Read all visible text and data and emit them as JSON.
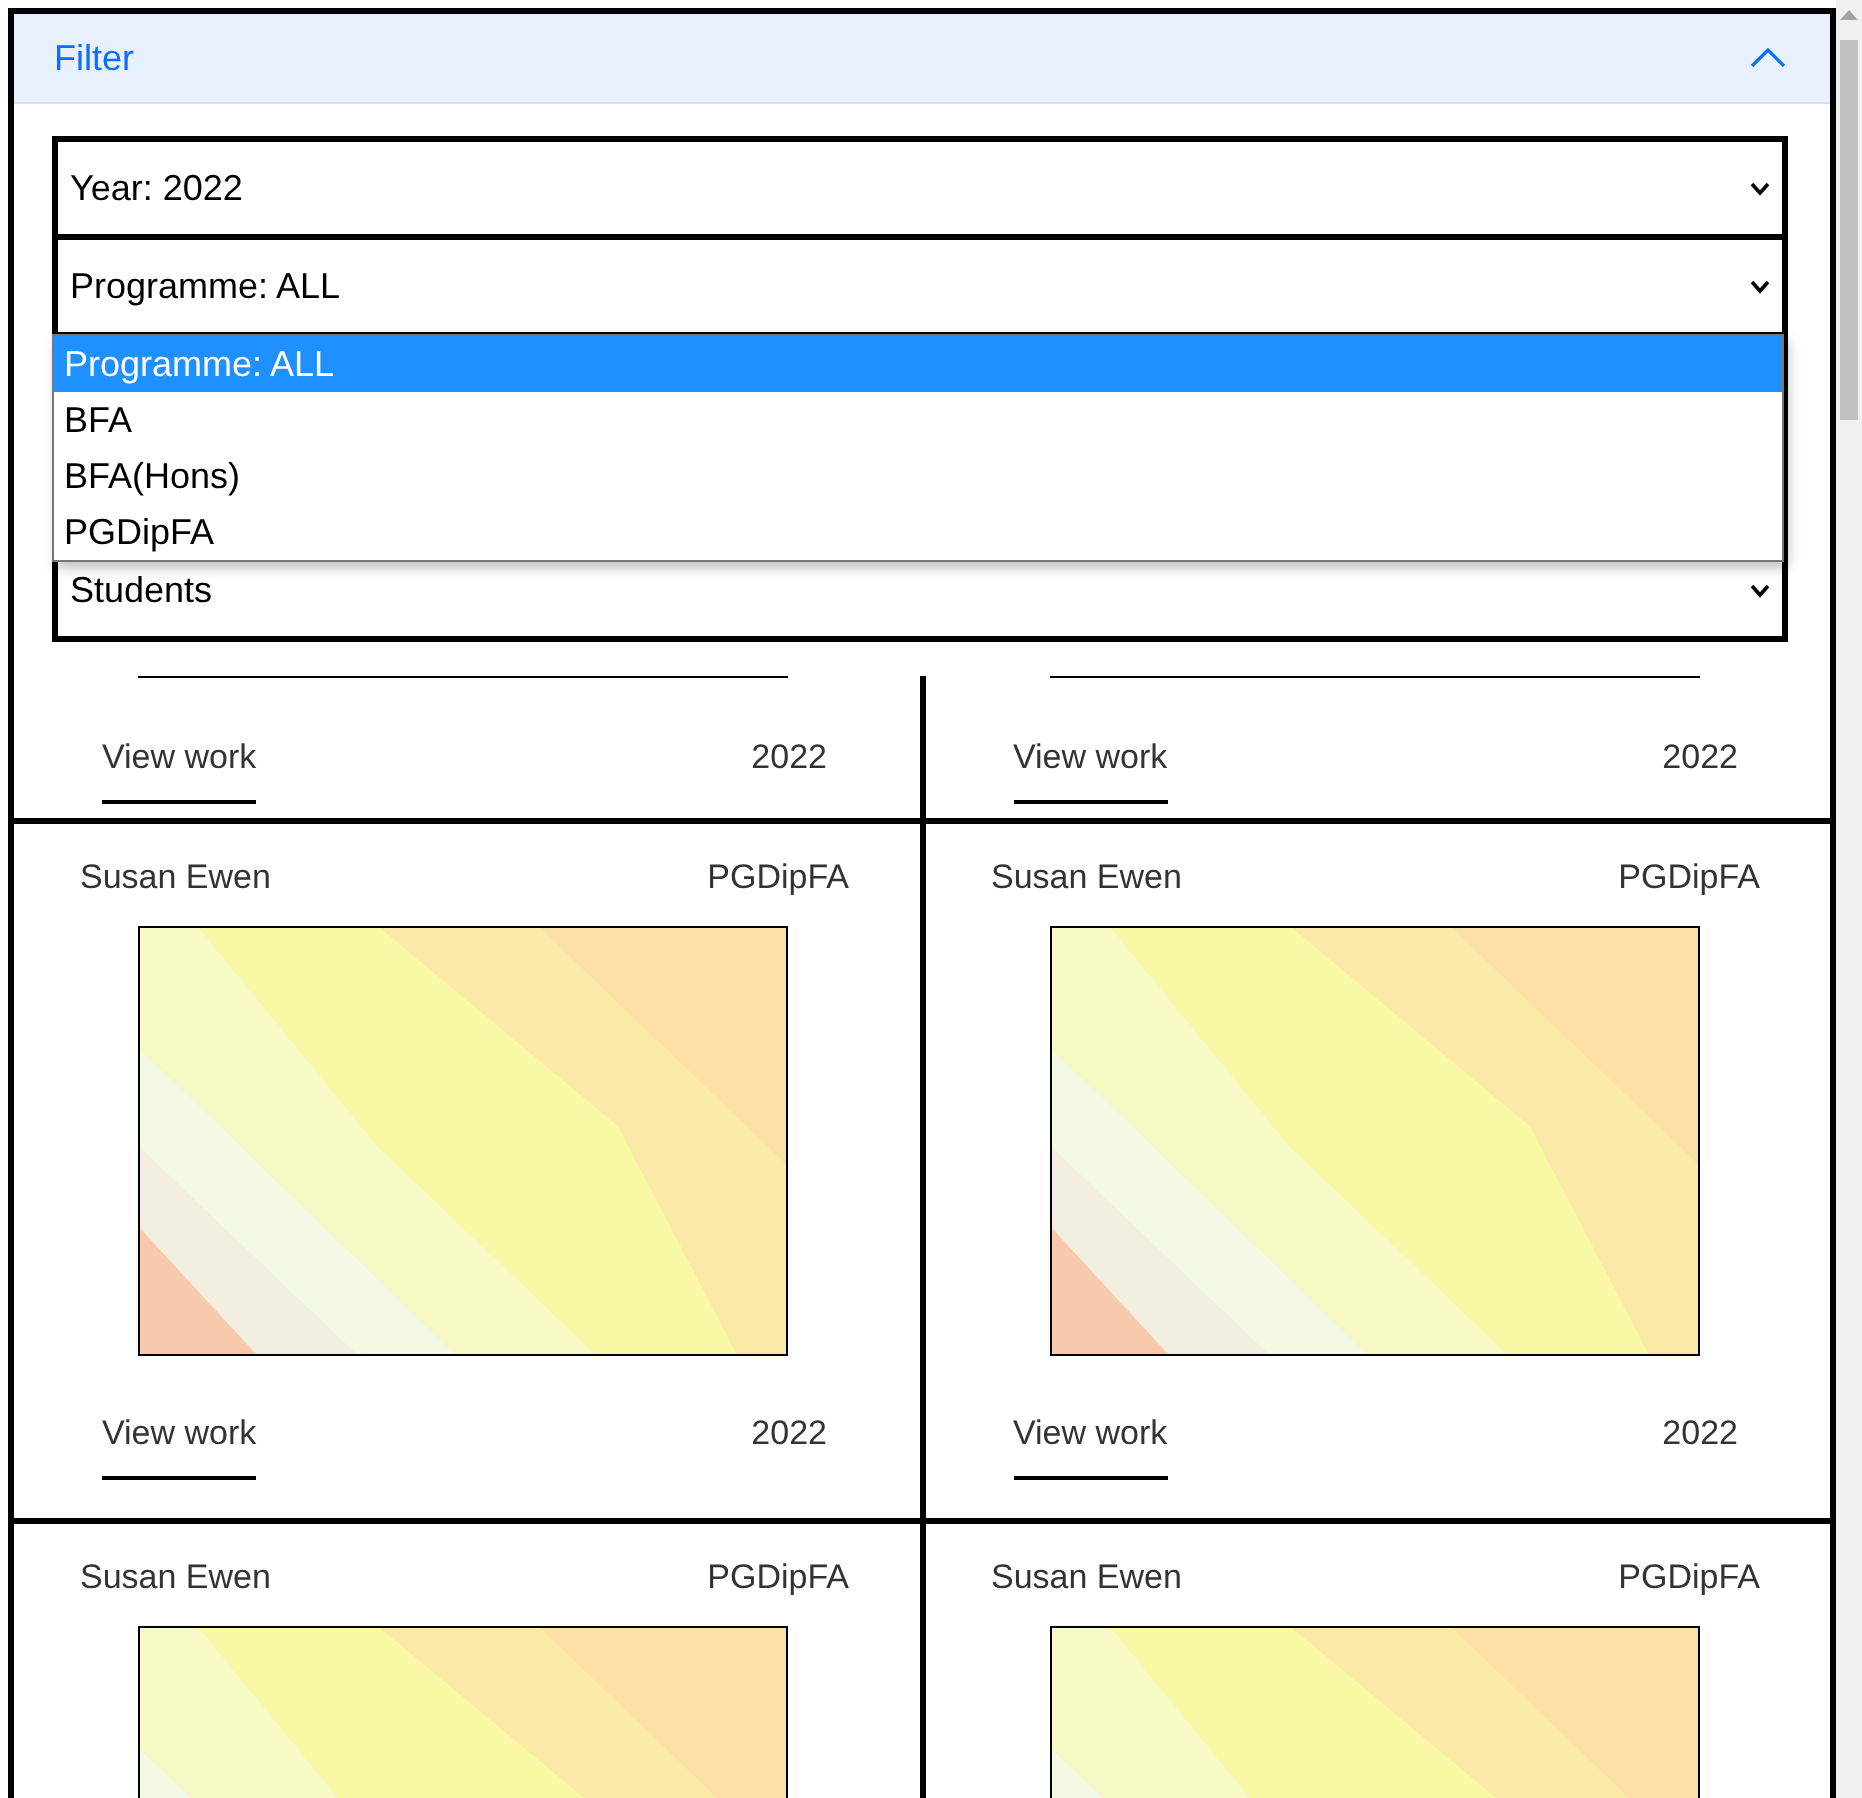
{
  "filter": {
    "title": "Filter",
    "expanded": true,
    "selects": [
      {
        "value": "Year: 2022"
      },
      {
        "value": "Programme: ALL",
        "open": true,
        "options": [
          {
            "label": "Programme: ALL",
            "selected": true
          },
          {
            "label": "BFA",
            "selected": false
          },
          {
            "label": "BFA(Hons)",
            "selected": false
          },
          {
            "label": "PGDipFA",
            "selected": false
          }
        ]
      },
      {
        "value": "Students"
      }
    ]
  },
  "card_rows": [
    {
      "kind": "partial",
      "cards": [
        {
          "link": "View work",
          "year": "2022"
        },
        {
          "link": "View work",
          "year": "2022"
        }
      ]
    },
    {
      "kind": "full",
      "cards": [
        {
          "name": "Susan Ewen",
          "programme": "PGDipFA",
          "link": "View work",
          "year": "2022"
        },
        {
          "name": "Susan Ewen",
          "programme": "PGDipFA",
          "link": "View work",
          "year": "2022"
        }
      ]
    },
    {
      "kind": "full",
      "cards": [
        {
          "name": "Susan Ewen",
          "programme": "PGDipFA"
        },
        {
          "name": "Susan Ewen",
          "programme": "PGDipFA"
        }
      ]
    }
  ]
}
